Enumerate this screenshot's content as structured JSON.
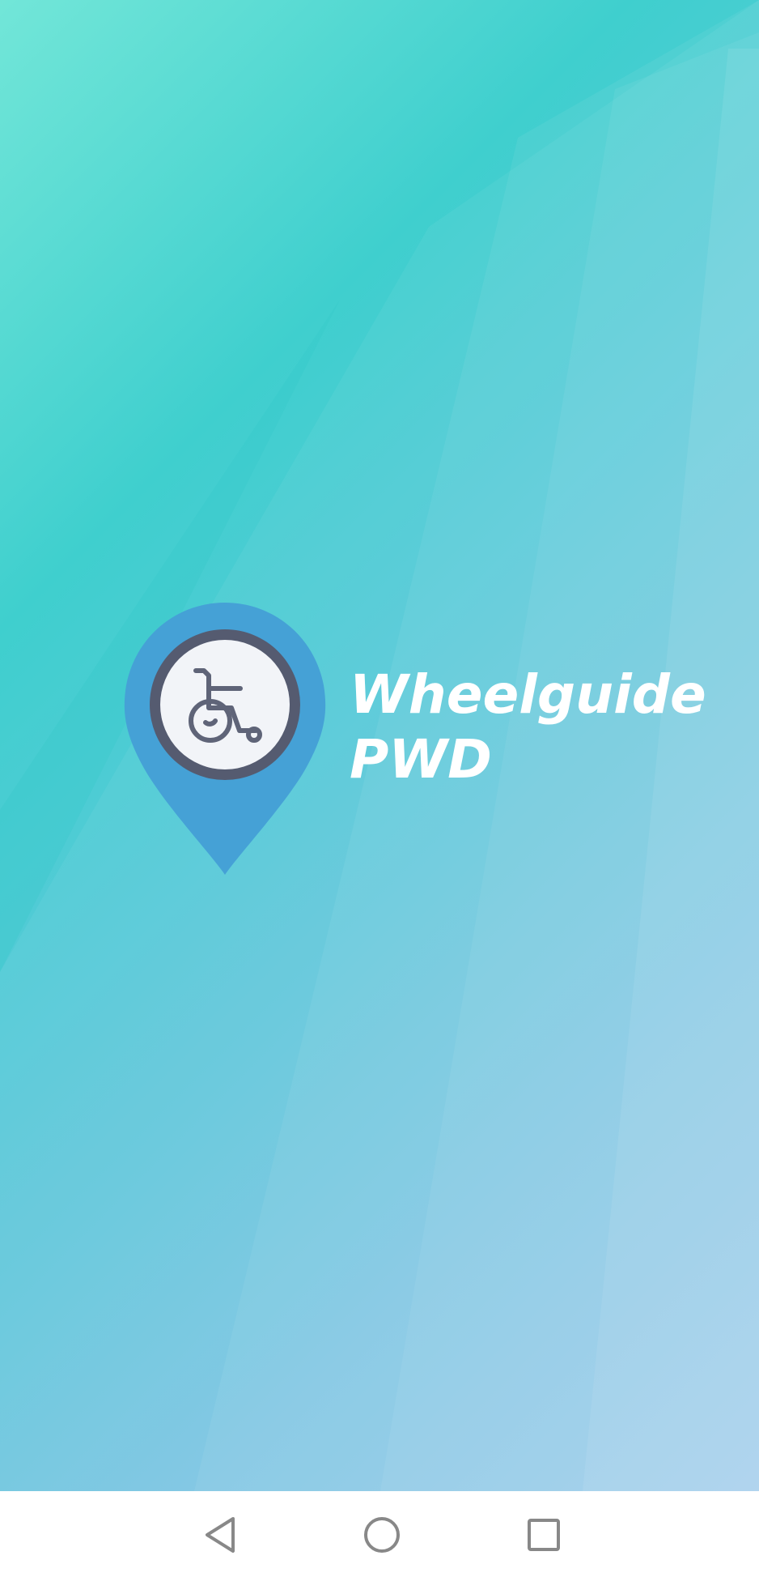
{
  "app": {
    "name_line1": "Wheelguide",
    "name_line2": "PWD",
    "logo_icon": "wheelchair-location-pin-icon"
  },
  "colors": {
    "pin_blue": "#45a1d6",
    "ring_dark": "#555b70",
    "inner_light": "#f2f4f8",
    "wheelchair_stroke": "#5f6478",
    "text": "#ffffff",
    "bg_teal": "#3fcfce",
    "bg_blue": "#9ccbea"
  },
  "navbar": {
    "back_icon": "triangle-back-icon",
    "home_icon": "circle-home-icon",
    "recents_icon": "square-recents-icon"
  }
}
